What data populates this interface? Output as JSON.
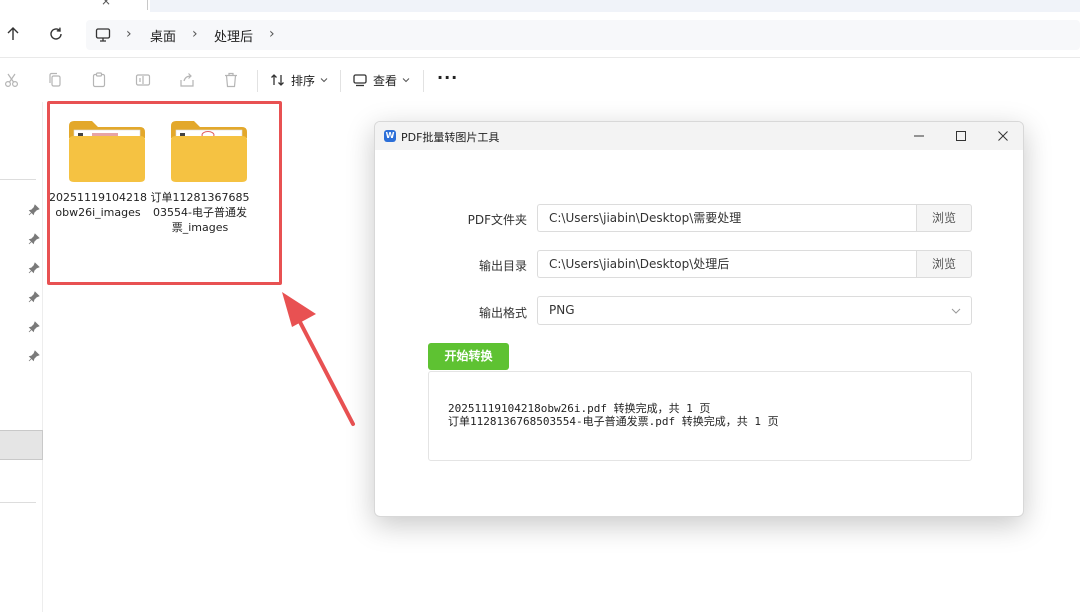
{
  "explorer": {
    "breadcrumb": [
      {
        "label": "桌面"
      },
      {
        "label": "处理后"
      }
    ],
    "toolbar": {
      "sort_label": "排序",
      "view_label": "查看",
      "more_label": "···"
    },
    "folders": [
      {
        "name": "20251119104218obw26i_images"
      },
      {
        "name": "订单1128136768503554-电子普通发票_images"
      }
    ]
  },
  "app": {
    "title": "PDF批量转图片工具",
    "logo_letter": "W",
    "pdf_folder": {
      "label": "PDF文件夹",
      "value": "C:\\Users\\jiabin\\Desktop\\需要处理",
      "browse_label": "浏览"
    },
    "output_dir": {
      "label": "输出目录",
      "value": "C:\\Users\\jiabin\\Desktop\\处理后",
      "browse_label": "浏览"
    },
    "output_format": {
      "label": "输出格式",
      "value": "PNG"
    },
    "start_label": "开始转换",
    "log": [
      "20251119104218obw26i.pdf 转换完成，共 1 页",
      "订单1128136768503554-电子普通发票.pdf 转换完成，共 1 页"
    ]
  },
  "colors": {
    "highlight": "#e85152",
    "start_button": "#5ec232",
    "folder": "#f5c242",
    "app_logo": "#2c6fd8"
  }
}
